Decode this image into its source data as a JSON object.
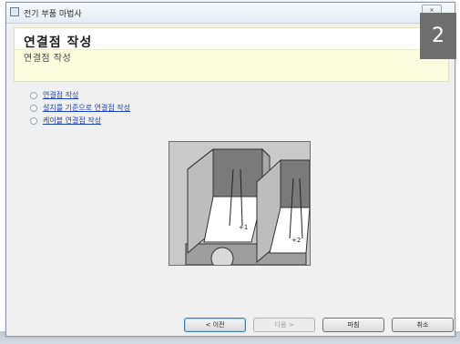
{
  "window": {
    "title": "전기 부품 마법사",
    "close_label": "닫기"
  },
  "header": {
    "title": "연결점 작성",
    "subtitle": "연결점 작성"
  },
  "steps": [
    {
      "label": "연결점 작성"
    },
    {
      "label": "설치를 기준으로 연결점 작성"
    },
    {
      "label": "케이블 연결점 작성"
    }
  ],
  "buttons": {
    "back": "< 이전",
    "next": "다음 >",
    "finish": "마침",
    "cancel": "취소"
  },
  "badge": "2"
}
